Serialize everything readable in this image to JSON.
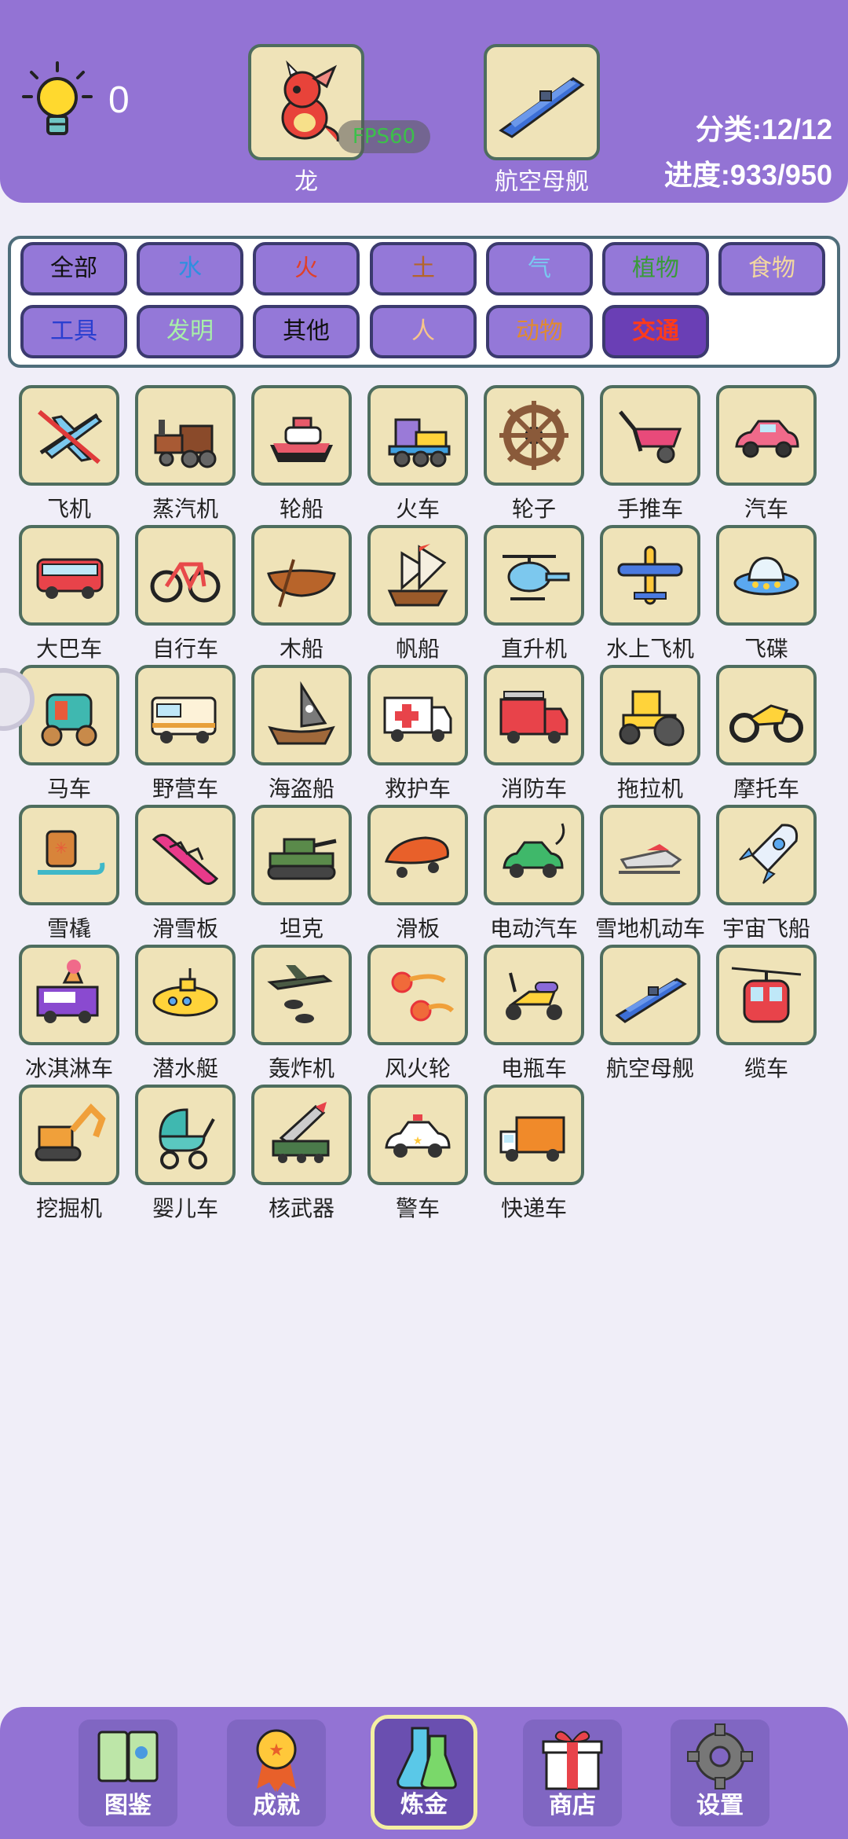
{
  "header": {
    "hint_count": "0",
    "slot_left_label": "龙",
    "slot_right_label": "航空母舰",
    "fps": "FPS60",
    "category_progress": "分类:12/12",
    "progress": "进度:933/950"
  },
  "filters": [
    {
      "label": "全部",
      "color": "#111111"
    },
    {
      "label": "水",
      "color": "#2f8fe0"
    },
    {
      "label": "火",
      "color": "#e0402a"
    },
    {
      "label": "土",
      "color": "#b5652a"
    },
    {
      "label": "气",
      "color": "#79c9f0"
    },
    {
      "label": "植物",
      "color": "#3a9a3a"
    },
    {
      "label": "食物",
      "color": "#f3d8a0"
    },
    {
      "label": "工具",
      "color": "#2a3fd0"
    },
    {
      "label": "发明",
      "color": "#a8f0a8"
    },
    {
      "label": "其他",
      "color": "#111111"
    },
    {
      "label": "人",
      "color": "#f7c58a"
    },
    {
      "label": "动物",
      "color": "#e08a30"
    },
    {
      "label": "交通",
      "color": "#ff3a1a",
      "active": true
    }
  ],
  "items": [
    {
      "label": "飞机",
      "icon": "airplane-icon"
    },
    {
      "label": "蒸汽机",
      "icon": "steam-locomotive-icon"
    },
    {
      "label": "轮船",
      "icon": "ship-icon"
    },
    {
      "label": "火车",
      "icon": "train-icon"
    },
    {
      "label": "轮子",
      "icon": "wheel-icon"
    },
    {
      "label": "手推车",
      "icon": "wheelbarrow-icon"
    },
    {
      "label": "汽车",
      "icon": "car-icon"
    },
    {
      "label": "大巴车",
      "icon": "bus-icon"
    },
    {
      "label": "自行车",
      "icon": "bicycle-icon"
    },
    {
      "label": "木船",
      "icon": "rowboat-icon"
    },
    {
      "label": "帆船",
      "icon": "sailing-ship-icon"
    },
    {
      "label": "直升机",
      "icon": "helicopter-icon"
    },
    {
      "label": "水上飞机",
      "icon": "seaplane-icon"
    },
    {
      "label": "飞碟",
      "icon": "ufo-icon"
    },
    {
      "label": "马车",
      "icon": "carriage-icon"
    },
    {
      "label": "野营车",
      "icon": "camper-icon"
    },
    {
      "label": "海盗船",
      "icon": "pirate-ship-icon"
    },
    {
      "label": "救护车",
      "icon": "ambulance-icon"
    },
    {
      "label": "消防车",
      "icon": "fire-truck-icon"
    },
    {
      "label": "拖拉机",
      "icon": "tractor-icon"
    },
    {
      "label": "摩托车",
      "icon": "motorcycle-icon"
    },
    {
      "label": "雪橇",
      "icon": "sled-icon"
    },
    {
      "label": "滑雪板",
      "icon": "snowboard-icon"
    },
    {
      "label": "坦克",
      "icon": "tank-icon"
    },
    {
      "label": "滑板",
      "icon": "skateboard-icon"
    },
    {
      "label": "电动汽车",
      "icon": "electric-car-icon"
    },
    {
      "label": "雪地机动车",
      "icon": "snowmobile-icon"
    },
    {
      "label": "宇宙飞船",
      "icon": "rocket-icon"
    },
    {
      "label": "冰淇淋车",
      "icon": "ice-cream-truck-icon"
    },
    {
      "label": "潜水艇",
      "icon": "submarine-icon"
    },
    {
      "label": "轰炸机",
      "icon": "bomber-icon"
    },
    {
      "label": "风火轮",
      "icon": "fire-wheels-icon"
    },
    {
      "label": "电瓶车",
      "icon": "scooter-icon"
    },
    {
      "label": "航空母舰",
      "icon": "aircraft-carrier-icon"
    },
    {
      "label": "缆车",
      "icon": "cable-car-icon"
    },
    {
      "label": "挖掘机",
      "icon": "excavator-icon"
    },
    {
      "label": "婴儿车",
      "icon": "stroller-icon"
    },
    {
      "label": "核武器",
      "icon": "missile-launcher-icon"
    },
    {
      "label": "警车",
      "icon": "police-car-icon"
    },
    {
      "label": "快递车",
      "icon": "delivery-truck-icon"
    }
  ],
  "nav": [
    {
      "label": "图鉴",
      "icon": "book-icon"
    },
    {
      "label": "成就",
      "icon": "medal-icon"
    },
    {
      "label": "炼金",
      "icon": "flask-icon",
      "active": true
    },
    {
      "label": "商店",
      "icon": "gift-icon"
    },
    {
      "label": "设置",
      "icon": "gear-icon"
    }
  ]
}
